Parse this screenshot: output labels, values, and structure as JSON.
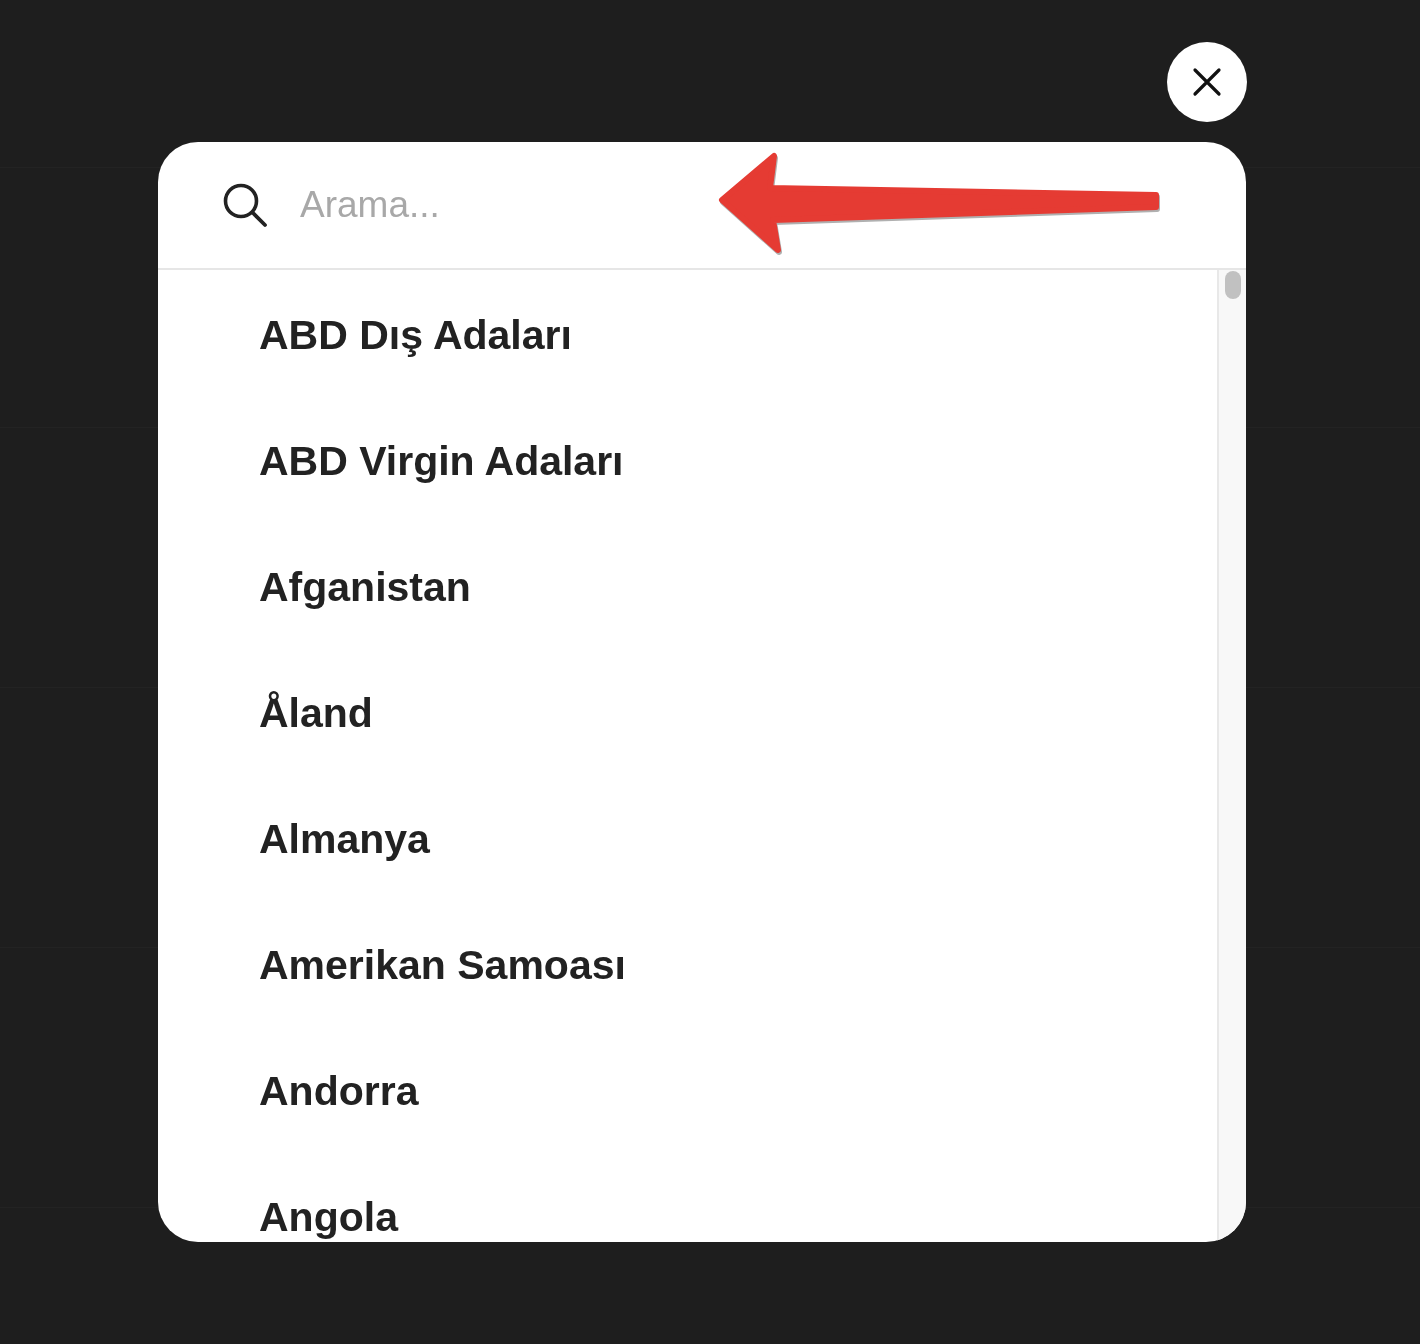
{
  "search": {
    "placeholder": "Arama..."
  },
  "countries": [
    "ABD Dış Adaları",
    "ABD Virgin Adaları",
    "Afganistan",
    "Åland",
    "Almanya",
    "Amerikan Samoası",
    "Andorra",
    "Angola"
  ]
}
